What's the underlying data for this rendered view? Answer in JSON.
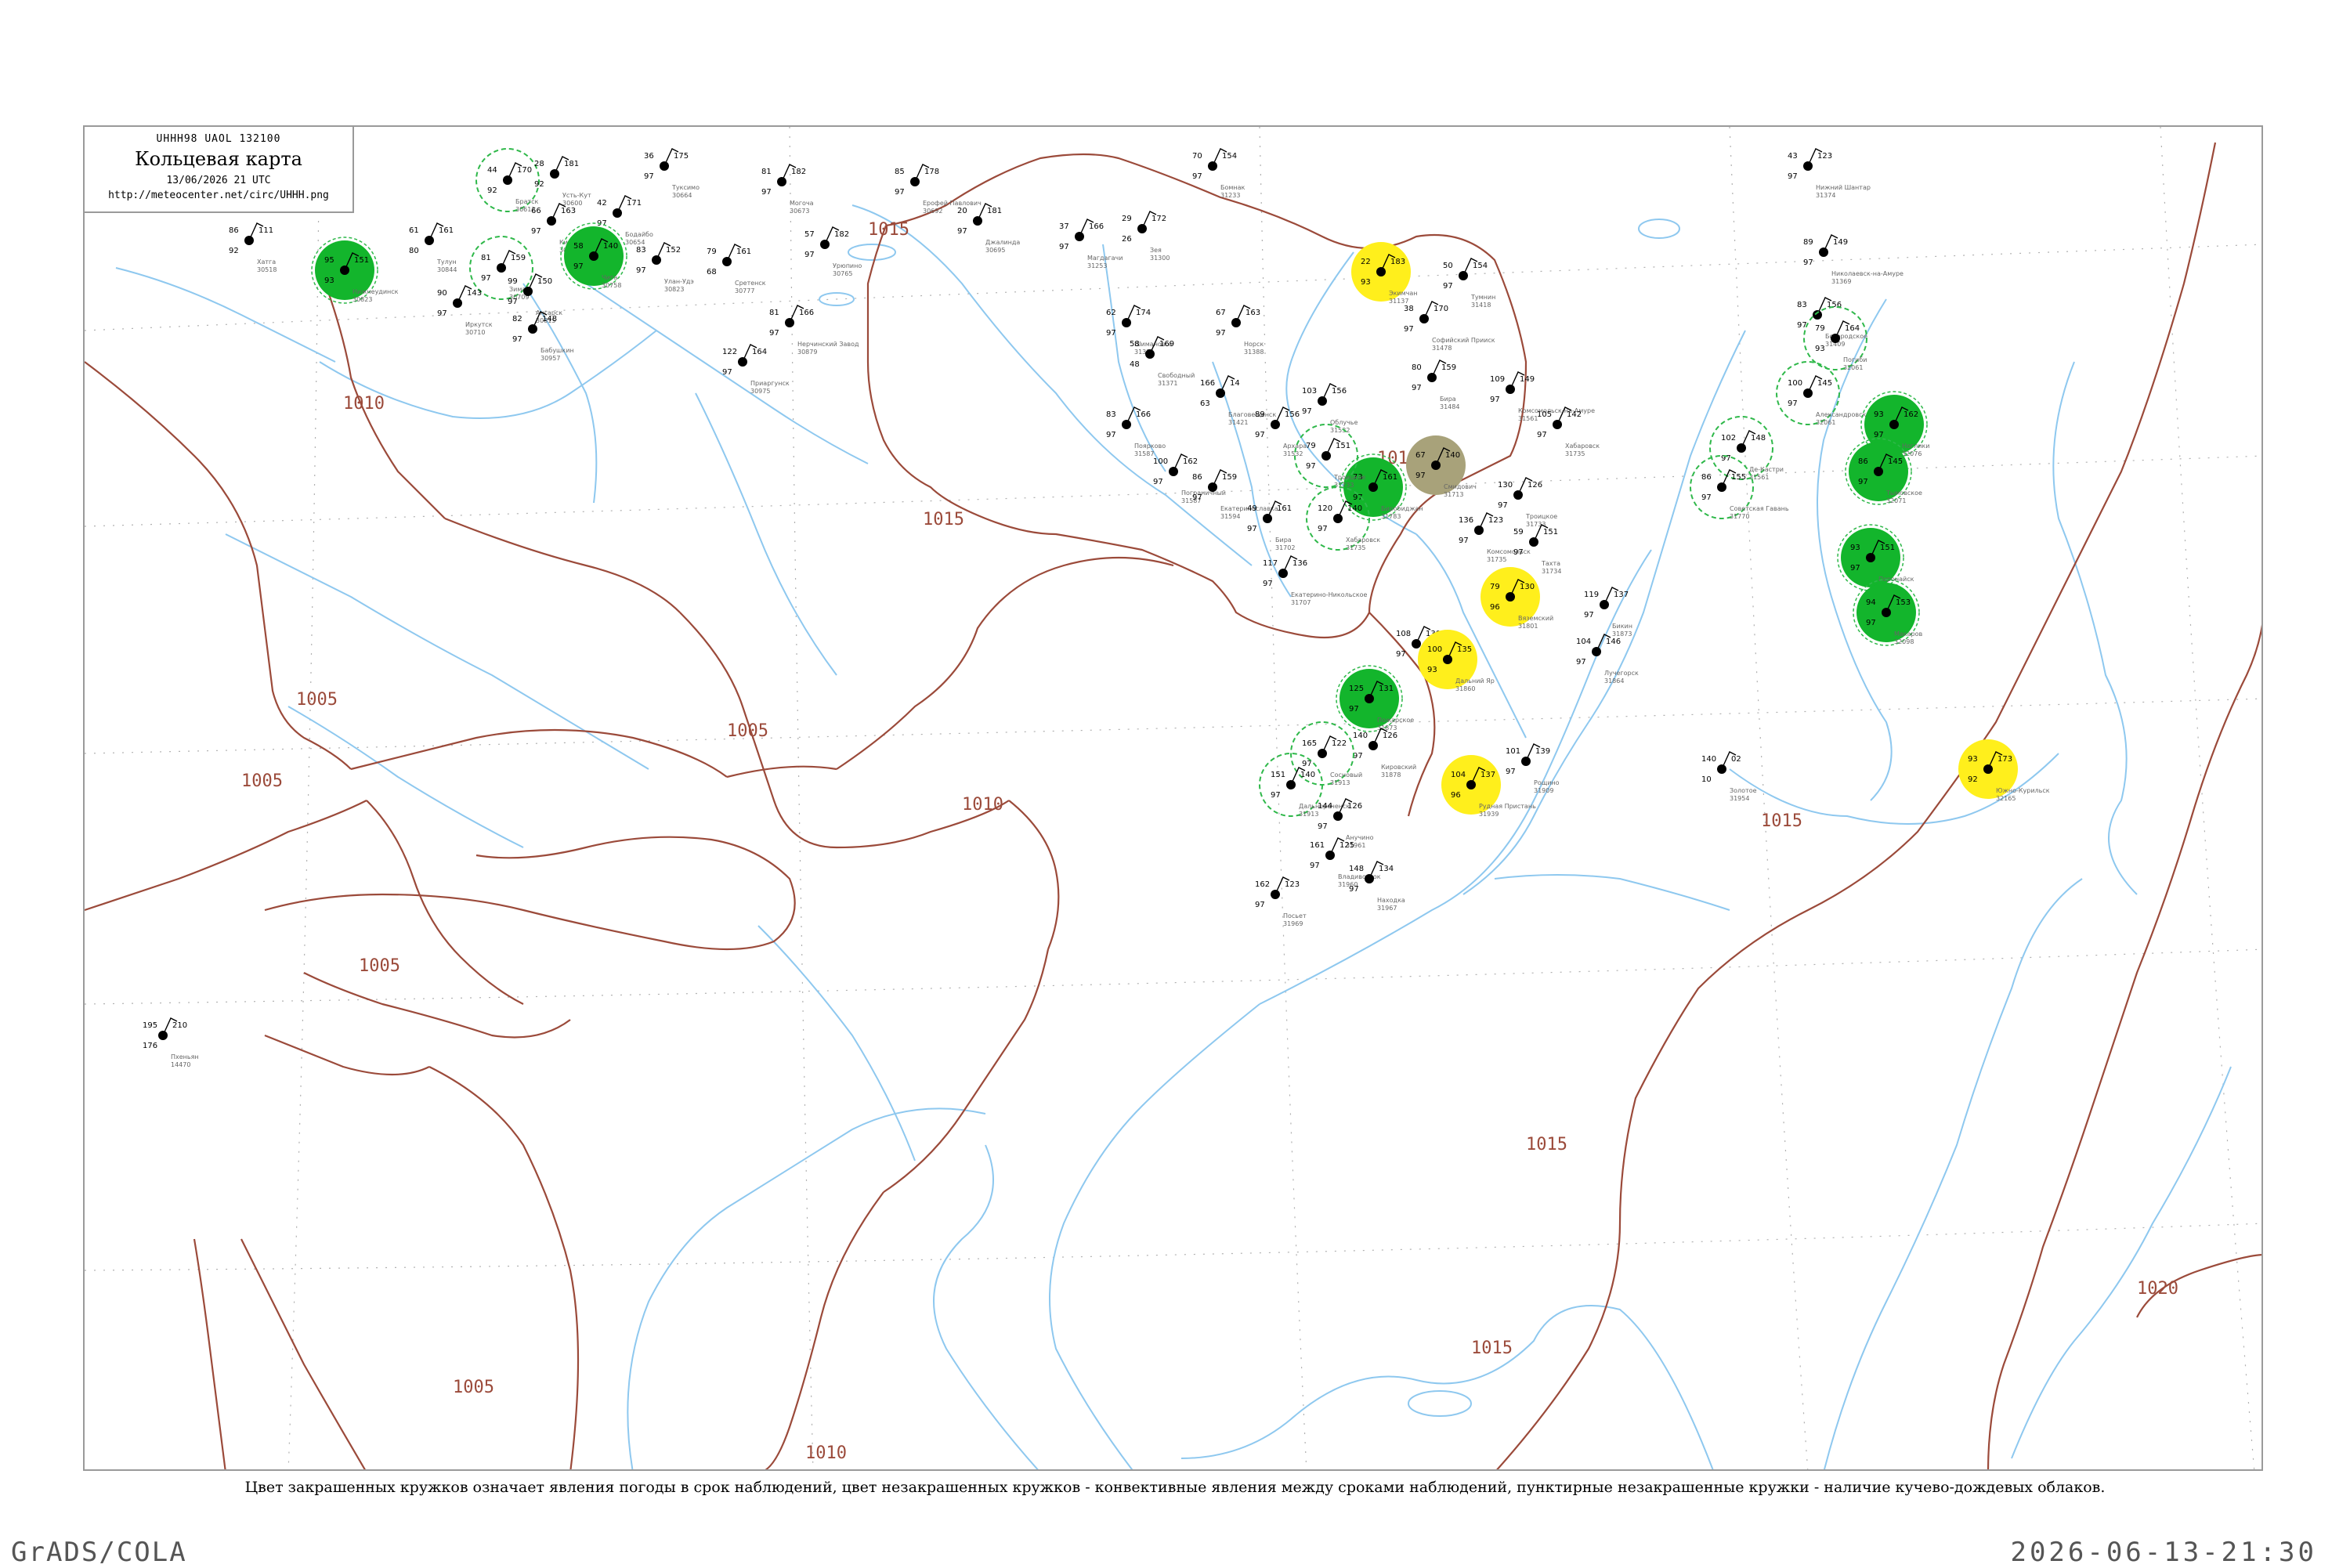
{
  "title": {
    "code": "UHHH98  UAOL  132100",
    "main": "Кольцевая карта",
    "date": "13/06/2026 21 UTC",
    "url": "http://meteocenter.net/circ/UHHH.png"
  },
  "legend_note": "Цвет закрашенных кружков означает явления погоды в срок наблюдений, цвет незакрашенных кружков - конвективные явления между сроками наблюдений, пунктирные незакрашенные кружки - наличие кучево-дождевых облаков.",
  "footer": {
    "left": "GrADS/COLA",
    "right": "2026-06-13-21:30"
  },
  "colors": {
    "isobar": "#9b4a3a",
    "coast": "#8ec8ef",
    "rain": "#13b52c",
    "fog": "#ffef1c",
    "haze": "#a8a27a",
    "cb_dashed": "#2fb84a",
    "grid": "#b0b0b0"
  },
  "isobar_labels": [
    "1015",
    "1010",
    "1005",
    "1005",
    "1005",
    "1005",
    "1010",
    "1015",
    "1015",
    "1015",
    "1015",
    "1015",
    "1020",
    "1005",
    "1010"
  ],
  "stations": [
    {
      "t": "86",
      "p": "111",
      "d": "92",
      "n": "Хатга",
      "id": "30518",
      "s": "clear"
    },
    {
      "t": "95",
      "p": "151",
      "d": "93",
      "n": "Нижнеудинск",
      "id": "30823",
      "s": "rain"
    },
    {
      "t": "44",
      "p": "170",
      "d": "92",
      "n": "Братск",
      "id": "30612",
      "s": "cb"
    },
    {
      "t": "61",
      "p": "161",
      "d": "80",
      "n": "Тулун",
      "id": "30844",
      "s": "clear"
    },
    {
      "t": "81",
      "p": "159",
      "d": "97",
      "n": "Зима",
      "id": "30709",
      "s": "cb"
    },
    {
      "t": "28",
      "p": "181",
      "d": "92",
      "n": "Усть-Кут",
      "id": "30600",
      "s": "clear"
    },
    {
      "t": "66",
      "p": "163",
      "d": "97",
      "n": "Киренск",
      "id": "30728",
      "s": "clear"
    },
    {
      "t": "90",
      "p": "143",
      "d": "97",
      "n": "Иркутск",
      "id": "30710",
      "s": "clear"
    },
    {
      "t": "99",
      "p": "150",
      "d": "97",
      "n": "Ангарск",
      "id": "30815",
      "s": "clear"
    },
    {
      "t": "82",
      "p": "148",
      "d": "97",
      "n": "Бабушкин",
      "id": "30957",
      "s": "clear"
    },
    {
      "t": "42",
      "p": "171",
      "d": "97",
      "n": "Бодайбо",
      "id": "30654",
      "s": "clear"
    },
    {
      "t": "36",
      "p": "175",
      "d": "97",
      "n": "Туксимо",
      "id": "30664",
      "s": "clear"
    },
    {
      "t": "83",
      "p": "152",
      "d": "97",
      "n": "Улан-Удэ",
      "id": "30823",
      "s": "clear"
    },
    {
      "t": "58",
      "p": "140",
      "d": "97",
      "n": "Чита",
      "id": "30758",
      "s": "rain"
    },
    {
      "t": "79",
      "p": "161",
      "d": "68",
      "n": "Сретенск",
      "id": "30777",
      "s": "clear"
    },
    {
      "t": "81",
      "p": "166",
      "d": "97",
      "n": "Нерчинский Завод",
      "id": "30879",
      "s": "clear"
    },
    {
      "t": "122",
      "p": "164",
      "d": "97",
      "n": "Приаргунск",
      "id": "30975",
      "s": "clear"
    },
    {
      "t": "81",
      "p": "182",
      "d": "97",
      "n": "Могоча",
      "id": "30673",
      "s": "clear"
    },
    {
      "t": "57",
      "p": "182",
      "d": "97",
      "n": "Урюпино",
      "id": "30765",
      "s": "clear"
    },
    {
      "t": "85",
      "p": "178",
      "d": "97",
      "n": "Ерофей Павлович",
      "id": "30692",
      "s": "clear"
    },
    {
      "t": "20",
      "p": "181",
      "d": "97",
      "n": "Джалинда",
      "id": "30695",
      "s": "clear"
    },
    {
      "t": "37",
      "p": "166",
      "d": "97",
      "n": "Магдагачи",
      "id": "31253",
      "s": "clear"
    },
    {
      "t": "29",
      "p": "172",
      "d": "26",
      "n": "Зея",
      "id": "31300",
      "s": "clear"
    },
    {
      "t": "70",
      "p": "154",
      "d": "97",
      "n": "Бомнак",
      "id": "31233",
      "s": "clear"
    },
    {
      "t": "62",
      "p": "174",
      "d": "97",
      "n": "Шимановск",
      "id": "31371",
      "s": "clear"
    },
    {
      "t": "58",
      "p": "169",
      "d": "48",
      "n": "Свободный",
      "id": "31371",
      "s": "clear"
    },
    {
      "t": "67",
      "p": "163",
      "d": "97",
      "n": "Норск",
      "id": "31388",
      "s": "clear"
    },
    {
      "t": "166",
      "p": "14",
      "d": "63",
      "n": "Благовещенск",
      "id": "31421",
      "s": "clear"
    },
    {
      "t": "89",
      "p": "156",
      "d": "97",
      "n": "Архара",
      "id": "31532",
      "s": "clear"
    },
    {
      "t": "103",
      "p": "156",
      "d": "97",
      "n": "Облучье",
      "id": "31532",
      "s": "clear"
    },
    {
      "t": "83",
      "p": "166",
      "d": "97",
      "n": "Поярково",
      "id": "31587",
      "s": "clear"
    },
    {
      "t": "100",
      "p": "162",
      "d": "97",
      "n": "Пограничный",
      "id": "31587",
      "s": "clear"
    },
    {
      "t": "86",
      "p": "159",
      "d": "97",
      "n": "Екатеринославка",
      "id": "31594",
      "s": "clear"
    },
    {
      "t": "49",
      "p": "161",
      "d": "97",
      "n": "Бира",
      "id": "31702",
      "s": "clear"
    },
    {
      "t": "22",
      "p": "183",
      "d": "93",
      "n": "Экимчан",
      "id": "31137",
      "s": "fog"
    },
    {
      "t": "38",
      "p": "170",
      "d": "97",
      "n": "Софийский Прииск",
      "id": "31478",
      "s": "clear"
    },
    {
      "t": "50",
      "p": "154",
      "d": "97",
      "n": "Тумнин",
      "id": "31418",
      "s": "clear"
    },
    {
      "t": "80",
      "p": "159",
      "d": "97",
      "n": "Бира",
      "id": "31484",
      "s": "clear"
    },
    {
      "t": "109",
      "p": "149",
      "d": "97",
      "n": "Комсомольск-на-Амуре",
      "id": "31561",
      "s": "clear"
    },
    {
      "t": "105",
      "p": "142",
      "d": "97",
      "n": "Хабаровск",
      "id": "31735",
      "s": "clear"
    },
    {
      "t": "73",
      "p": "161",
      "d": "97",
      "n": "Биробиджан",
      "id": "31783",
      "s": "rain"
    },
    {
      "t": "67",
      "p": "140",
      "d": "97",
      "n": "Смидович",
      "id": "31713",
      "s": "haze"
    },
    {
      "t": "79",
      "p": "151",
      "d": "97",
      "n": "Троицкое",
      "id": "31733",
      "s": "cb"
    },
    {
      "t": "120",
      "p": "140",
      "d": "97",
      "n": "Хабаровск",
      "id": "31735",
      "s": "cb"
    },
    {
      "t": "130",
      "p": "126",
      "d": "97",
      "n": "Троицкое",
      "id": "31733",
      "s": "clear"
    },
    {
      "t": "136",
      "p": "123",
      "d": "97",
      "n": "Комсомольск",
      "id": "31735",
      "s": "clear"
    },
    {
      "t": "59",
      "p": "151",
      "d": "97",
      "n": "Тахта",
      "id": "31734",
      "s": "clear"
    },
    {
      "t": "117",
      "p": "136",
      "d": "97",
      "n": "Екатерино-Никольское",
      "id": "31707",
      "s": "clear"
    },
    {
      "t": "79",
      "p": "130",
      "d": "96",
      "n": "Вяземский",
      "id": "31801",
      "s": "fog"
    },
    {
      "t": "119",
      "p": "137",
      "d": "97",
      "n": "Бикин",
      "id": "31873",
      "s": "clear"
    },
    {
      "t": "104",
      "p": "146",
      "d": "97",
      "n": "Лучегорск",
      "id": "31864",
      "s": "clear"
    },
    {
      "t": "108",
      "p": "130",
      "d": "97",
      "n": "Бикин",
      "id": "31873",
      "s": "clear"
    },
    {
      "t": "100",
      "p": "135",
      "d": "93",
      "n": "Дальний Яр",
      "id": "31860",
      "s": "fog"
    },
    {
      "t": "125",
      "p": "131",
      "d": "97",
      "n": "Пожарское",
      "id": "31873",
      "s": "rain"
    },
    {
      "t": "140",
      "p": "126",
      "d": "97",
      "n": "Кировский",
      "id": "31878",
      "s": "clear"
    },
    {
      "t": "101",
      "p": "139",
      "d": "97",
      "n": "Рощино",
      "id": "31909",
      "s": "clear"
    },
    {
      "t": "104",
      "p": "137",
      "d": "96",
      "n": "Рудная Пристань",
      "id": "31939",
      "s": "fog"
    },
    {
      "t": "140",
      "p": "02",
      "d": "10",
      "n": "Золотое",
      "id": "31954",
      "s": "clear"
    },
    {
      "t": "165",
      "p": "122",
      "d": "97",
      "n": "Сосновый",
      "id": "31913",
      "s": "cb"
    },
    {
      "t": "151",
      "p": "140",
      "d": "97",
      "n": "Дальнереченск",
      "id": "31913",
      "s": "cb"
    },
    {
      "t": "144",
      "p": "126",
      "d": "97",
      "n": "Анучино",
      "id": "31961",
      "s": "clear"
    },
    {
      "t": "161",
      "p": "125",
      "d": "97",
      "n": "Владивосток",
      "id": "31960",
      "s": "clear"
    },
    {
      "t": "148",
      "p": "134",
      "d": "97",
      "n": "Находка",
      "id": "31967",
      "s": "clear"
    },
    {
      "t": "162",
      "p": "123",
      "d": "97",
      "n": "Посьет",
      "id": "31969",
      "s": "clear"
    },
    {
      "t": "43",
      "p": "123",
      "d": "97",
      "n": "Нижний Шантар",
      "id": "31374",
      "s": "clear"
    },
    {
      "t": "89",
      "p": "149",
      "d": "97",
      "n": "Николаевск-на-Амуре",
      "id": "31369",
      "s": "clear"
    },
    {
      "t": "83",
      "p": "156",
      "d": "97",
      "n": "Богородское",
      "id": "31409",
      "s": "clear"
    },
    {
      "t": "79",
      "p": "164",
      "d": "93",
      "n": "Погиби",
      "id": "32061",
      "s": "cb"
    },
    {
      "t": "100",
      "p": "145",
      "d": "97",
      "n": "Александровск",
      "id": "32061",
      "s": "cb"
    },
    {
      "t": "93",
      "p": "162",
      "d": "97",
      "n": "Ноглики",
      "id": "32076",
      "s": "rain"
    },
    {
      "t": "86",
      "p": "145",
      "d": "97",
      "n": "Тымовское",
      "id": "32071",
      "s": "rain"
    },
    {
      "t": "102",
      "p": "148",
      "d": "97",
      "n": "Де-Кастри",
      "id": "31561",
      "s": "cb"
    },
    {
      "t": "86",
      "p": "155",
      "d": "97",
      "n": "Советская Гавань",
      "id": "31770",
      "s": "cb"
    },
    {
      "t": "93",
      "p": "151",
      "d": "97",
      "n": "Поронайск",
      "id": "32098",
      "s": "rain"
    },
    {
      "t": "94",
      "p": "153",
      "d": "97",
      "n": "Макаров",
      "id": "32098",
      "s": "rain"
    },
    {
      "t": "93",
      "p": "173",
      "d": "92",
      "n": "Южно-Курильск",
      "id": "32165",
      "s": "fog"
    },
    {
      "t": "195",
      "p": "210",
      "d": "176",
      "n": "Пхеньян",
      "id": "14470",
      "s": "clear"
    }
  ]
}
